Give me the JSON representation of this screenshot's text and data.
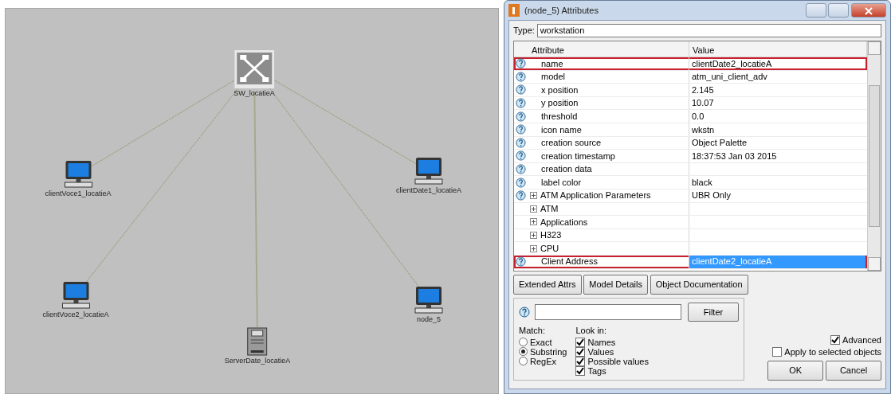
{
  "canvas": {
    "nodes": [
      {
        "label": "SW_locatieA",
        "kind": "switch"
      },
      {
        "label": "clientVoce1_locatieA",
        "kind": "workstation"
      },
      {
        "label": "clientVoce2_locatieA",
        "kind": "workstation"
      },
      {
        "label": "ServerDate_locatieA",
        "kind": "server"
      },
      {
        "label": "clientDate1_locatieA",
        "kind": "workstation"
      },
      {
        "label": "node_5",
        "kind": "workstation"
      }
    ]
  },
  "dialog": {
    "title": "(node_5) Attributes",
    "type_label": "Type:",
    "type_value": "workstation",
    "columns": [
      "Attribute",
      "Value"
    ],
    "rows": [
      {
        "kind": "attribute",
        "attribute": "name",
        "value": "clientDate2_locatieA",
        "highlighted": true,
        "selected": false
      },
      {
        "kind": "attribute",
        "attribute": "model",
        "value": "atm_uni_client_adv",
        "highlighted": false,
        "selected": false
      },
      {
        "kind": "attribute",
        "attribute": "x position",
        "value": "2.145",
        "highlighted": false,
        "selected": false
      },
      {
        "kind": "attribute",
        "attribute": "y position",
        "value": "10.07",
        "highlighted": false,
        "selected": false
      },
      {
        "kind": "attribute",
        "attribute": "threshold",
        "value": "0.0",
        "highlighted": false,
        "selected": false
      },
      {
        "kind": "attribute",
        "attribute": "icon name",
        "value": "wkstn",
        "highlighted": false,
        "selected": false
      },
      {
        "kind": "attribute",
        "attribute": "creation source",
        "value": "Object Palette",
        "highlighted": false,
        "selected": false
      },
      {
        "kind": "attribute",
        "attribute": "creation timestamp",
        "value": "18:37:53 Jan 03 2015",
        "highlighted": false,
        "selected": false
      },
      {
        "kind": "attribute",
        "attribute": "creation data",
        "highlighted": false,
        "selected": false
      },
      {
        "kind": "attribute",
        "attribute": "label color",
        "value": "black",
        "highlighted": false,
        "selected": false
      },
      {
        "kind": "group_help",
        "attribute": "ATM Application Parameters",
        "value": "UBR Only",
        "highlighted": false,
        "selected": false
      },
      {
        "kind": "group",
        "attribute": "ATM",
        "highlighted": false,
        "selected": false
      },
      {
        "kind": "group",
        "attribute": "Applications",
        "highlighted": false,
        "selected": false
      },
      {
        "kind": "group",
        "attribute": "H323",
        "highlighted": false,
        "selected": false
      },
      {
        "kind": "group",
        "attribute": "CPU",
        "highlighted": false,
        "selected": false
      },
      {
        "kind": "attribute",
        "attribute": "Client Address",
        "value": "clientDate2_locatieA",
        "highlighted": true,
        "selected": true
      }
    ],
    "buttons": [
      "Extended Attrs",
      "Model Details",
      "Object Documentation"
    ],
    "filter_button": "Filter",
    "match_label": "Match:",
    "match_options": [
      {
        "label": "Exact",
        "selected": false
      },
      {
        "label": "Substring",
        "selected": true
      },
      {
        "label": "RegEx",
        "selected": false
      }
    ],
    "look_in_label": "Look in:",
    "look_in": [
      {
        "label": "Names",
        "checked": true
      },
      {
        "label": "Values",
        "checked": true
      },
      {
        "label": "Possible values",
        "checked": true
      },
      {
        "label": "Tags",
        "checked": true
      }
    ],
    "advanced": {
      "label": "Advanced",
      "checked": true
    },
    "apply_selected": {
      "label": "Apply to selected objects",
      "checked": false
    },
    "ok": "OK",
    "cancel": "Cancel"
  }
}
